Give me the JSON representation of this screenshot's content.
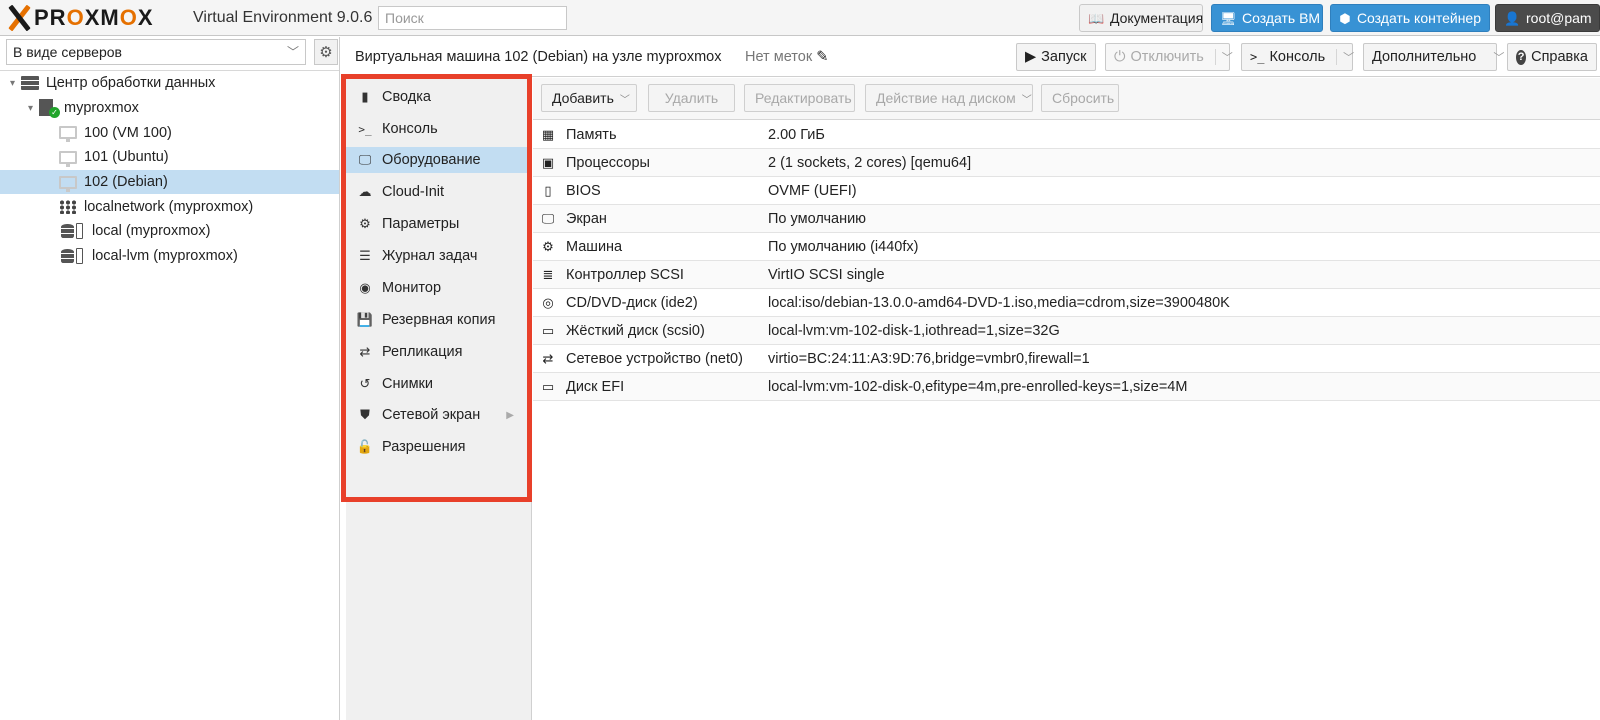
{
  "header": {
    "logo_text_pre": "PR",
    "logo_text_o1": "O",
    "logo_text_mid": "XM",
    "logo_text_o2": "O",
    "logo_text_post": "X",
    "version": "Virtual Environment 9.0.6",
    "search_placeholder": "Поиск",
    "docs_label": "Документация",
    "create_vm_label": "Создать ВМ",
    "create_ct_label": "Создать контейнер",
    "user_label": "root@pam"
  },
  "sidebar": {
    "view_mode": "В виде серверов",
    "tree": [
      {
        "label": "Центр обработки данных",
        "type": "datacenter"
      },
      {
        "label": "myproxmox",
        "type": "node"
      },
      {
        "label": "100 (VM 100)",
        "type": "vm"
      },
      {
        "label": "101 (Ubuntu)",
        "type": "vm"
      },
      {
        "label": "102 (Debian)",
        "type": "vm",
        "selected": true
      },
      {
        "label": "localnetwork (myproxmox)",
        "type": "network"
      },
      {
        "label": "local (myproxmox)",
        "type": "storage"
      },
      {
        "label": "local-lvm (myproxmox)",
        "type": "storage"
      }
    ]
  },
  "titlebar": {
    "title": "Виртуальная машина 102 (Debian) на узле myproxmox",
    "tags": "Нет меток",
    "start_label": "Запуск",
    "shutdown_label": "Отключить",
    "console_label": "Консоль",
    "more_label": "Дополнительно",
    "help_label": "Справка"
  },
  "menu": {
    "items": [
      {
        "label": "Сводка",
        "icon": "book-icon"
      },
      {
        "label": "Консоль",
        "icon": "terminal-icon"
      },
      {
        "label": "Оборудование",
        "icon": "monitor-icon",
        "selected": true
      },
      {
        "label": "Cloud-Init",
        "icon": "cloud-icon"
      },
      {
        "label": "Параметры",
        "icon": "gear-icon"
      },
      {
        "label": "Журнал задач",
        "icon": "list-icon"
      },
      {
        "label": "Монитор",
        "icon": "eye-icon"
      },
      {
        "label": "Резервная копия",
        "icon": "floppy-icon"
      },
      {
        "label": "Репликация",
        "icon": "retweet-icon"
      },
      {
        "label": "Снимки",
        "icon": "history-icon"
      },
      {
        "label": "Сетевой экран",
        "icon": "shield-icon",
        "has_submenu": true
      },
      {
        "label": "Разрешения",
        "icon": "unlock-icon"
      }
    ]
  },
  "hw_toolbar": {
    "add_label": "Добавить",
    "remove_label": "Удалить",
    "edit_label": "Редактировать",
    "disk_action_label": "Действие над диском",
    "revert_label": "Сбросить"
  },
  "hardware": [
    {
      "icon": "memory-icon",
      "name": "Память",
      "value": "2.00 ГиБ"
    },
    {
      "icon": "cpu-icon",
      "name": "Процессоры",
      "value": "2 (1 sockets, 2 cores) [qemu64]"
    },
    {
      "icon": "chip-icon",
      "name": "BIOS",
      "value": "OVMF (UEFI)"
    },
    {
      "icon": "desktop-icon",
      "name": "Экран",
      "value": "По умолчанию"
    },
    {
      "icon": "cogs-icon",
      "name": "Машина",
      "value": "По умолчанию (i440fx)"
    },
    {
      "icon": "database-icon",
      "name": "Контроллер SCSI",
      "value": "VirtIO SCSI single"
    },
    {
      "icon": "cdrom-icon",
      "name": "CD/DVD-диск (ide2)",
      "value": "local:iso/debian-13.0.0-amd64-DVD-1.iso,media=cdrom,size=3900480K"
    },
    {
      "icon": "hdd-icon",
      "name": "Жёсткий диск (scsi0)",
      "value": "local-lvm:vm-102-disk-1,iothread=1,size=32G"
    },
    {
      "icon": "exchange-icon",
      "name": "Сетевое устройство (net0)",
      "value": "virtio=BC:24:11:A3:9D:76,bridge=vmbr0,firewall=1"
    },
    {
      "icon": "hdd-icon",
      "name": "Диск EFI",
      "value": "local-lvm:vm-102-disk-0,efitype=4m,pre-enrolled-keys=1,size=4M"
    }
  ]
}
